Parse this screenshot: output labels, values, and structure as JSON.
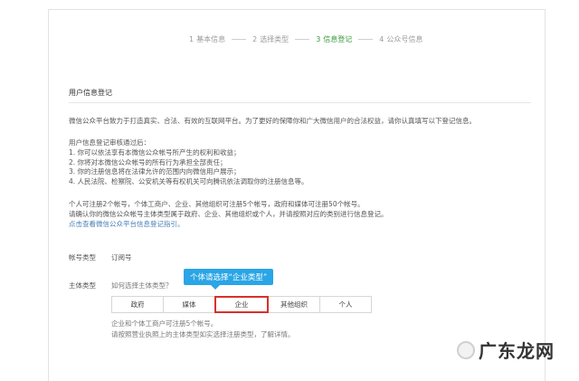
{
  "steps": [
    {
      "num": "1",
      "label": "基本信息"
    },
    {
      "num": "2",
      "label": "选择类型"
    },
    {
      "num": "3",
      "label": "信息登记"
    },
    {
      "num": "4",
      "label": "公众号信息"
    }
  ],
  "colors": {
    "active_step": "#3a9a3a",
    "tip_bg": "#2aa5e6",
    "highlight": "#d9302c",
    "link": "#4a7fb5"
  },
  "section": {
    "title": "用户信息登记"
  },
  "intro": "微信公众平台致力于打造真实、合法、有效的互联网平台。为了更好的保障你和广大微信用户的合法权益，请你认真填写以下登记信息。",
  "review": {
    "heading": "用户信息登记审核通过后：",
    "items": [
      "1. 你可以依法享有本微信公众帐号所产生的权利和收益；",
      "2. 你将对本微信公众帐号的所有行为承担全部责任；",
      "3. 你的注册信息将在法律允许的范围内向微信用户展示；",
      "4. 人民法院、检察院、公安机关等有权机关可向腾讯依法调取你的注册信息等。"
    ]
  },
  "rules": {
    "line1": "个人可注册2个帐号，个体工商户、企业、其他组织可注册5个帐号，政府和媒体可注册50个帐号。",
    "line2": "请确认你的微信公众帐号主体类型属于政府、企业、其他组织或个人，并请按照对应的类别进行信息登记。",
    "link": "点击查看微信公众平台信息登记指引。"
  },
  "form": {
    "account_type_label": "帐号类型",
    "account_type_value": "订阅号",
    "subject_type_label": "主体类型",
    "subject_question": "如何选择主体类型？",
    "tip": "个体请选择“企业类型”",
    "options": [
      "政府",
      "媒体",
      "企业",
      "其他组织",
      "个人"
    ],
    "selected_index": 2,
    "hint_line1": "企业和个体工商户可注册5个帐号。",
    "hint_line2": "请按照营业执照上的主体类型如实选择注册类型，了解详情。"
  },
  "watermark": {
    "text": "广东龙网"
  }
}
